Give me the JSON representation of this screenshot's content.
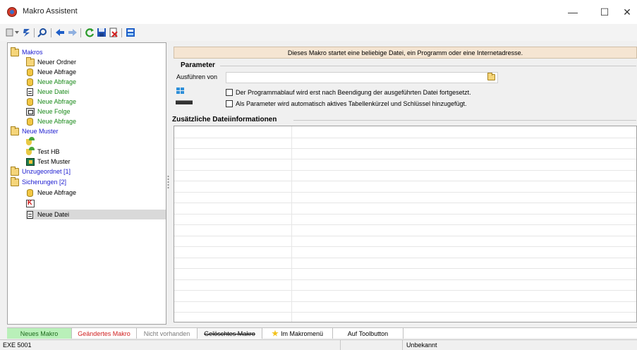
{
  "window": {
    "title": "Makro Assistent",
    "controls": {
      "minimize": "—",
      "maximize": "☐",
      "close": "✕"
    }
  },
  "toolbar": {
    "icons": [
      "new-macro-icon",
      "run-icon",
      "search-icon",
      "back-arrow-icon",
      "forward-arrow-icon",
      "refresh-icon",
      "save-icon",
      "delete-icon",
      "macro-menu-icon"
    ]
  },
  "tree": {
    "items": [
      {
        "label": "Makros",
        "icon": "folder",
        "color": "#1a1ad0",
        "indent": 0
      },
      {
        "label": "Neuer Ordner",
        "icon": "folder",
        "color": "#000000",
        "indent": 1
      },
      {
        "label": "Neue Abfrage",
        "icon": "query",
        "color": "#000000",
        "indent": 1
      },
      {
        "label": "Neue Abfrage",
        "icon": "query",
        "color": "#1b8a1b",
        "indent": 1
      },
      {
        "label": "Neue Datei",
        "icon": "file",
        "color": "#1b8a1b",
        "indent": 1
      },
      {
        "label": "Neue Abfrage",
        "icon": "query",
        "color": "#1b8a1b",
        "indent": 1
      },
      {
        "label": "Neue Folge",
        "icon": "sequence",
        "color": "#1b8a1b",
        "indent": 1
      },
      {
        "label": "Neue Abfrage",
        "icon": "query",
        "color": "#1b8a1b",
        "indent": 1
      },
      {
        "label": "Neue Muster",
        "icon": "folder",
        "color": "#1a1ad0",
        "indent": 0
      },
      {
        "label": "",
        "icon": "pattern",
        "color": "#000000",
        "indent": 1
      },
      {
        "label": "Test HB",
        "icon": "pattern",
        "color": "#000000",
        "indent": 1
      },
      {
        "label": "Test Muster",
        "icon": "exe",
        "color": "#000000",
        "indent": 1
      },
      {
        "label": "Unzugeordnet [1]",
        "icon": "folder",
        "color": "#1a1ad0",
        "indent": 0
      },
      {
        "label": "Sicherungen [2]",
        "icon": "folder",
        "color": "#1a1ad0",
        "indent": 0
      },
      {
        "label": "Neue Abfrage",
        "icon": "query",
        "color": "#000000",
        "indent": 1
      },
      {
        "label": "",
        "icon": "stamp",
        "color": "#000000",
        "indent": 1
      },
      {
        "label": "Neue Datei",
        "icon": "file",
        "color": "#000000",
        "indent": 1,
        "selected": true
      }
    ]
  },
  "detail": {
    "banner": "Dieses Makro startet eine beliebige Datei, ein Programm oder eine Internetadresse.",
    "parameter_title": "Parameter",
    "run_from_label": "Ausführen von",
    "run_from_value": "",
    "checkbox_wait": "Der Programmablauf wird erst nach Beendigung der ausgeführten Datei fortgesetzt.",
    "checkbox_params": "Als Parameter wird automatisch aktives Tabellenkürzel und Schlüssel hinzugefügt.",
    "additional_title": "Zusätzliche Dateiinformationen"
  },
  "legend": {
    "new": "Neues Makro",
    "changed": "Geändertes Makro",
    "missing": "Nicht vorhanden",
    "deleted": "Gelöschtes Makro",
    "in_menu": "Im Makromenü",
    "on_toolbutton": "Auf Toolbutton"
  },
  "statusbar": {
    "type": "EXE 5001",
    "status": "Unbekannt"
  }
}
